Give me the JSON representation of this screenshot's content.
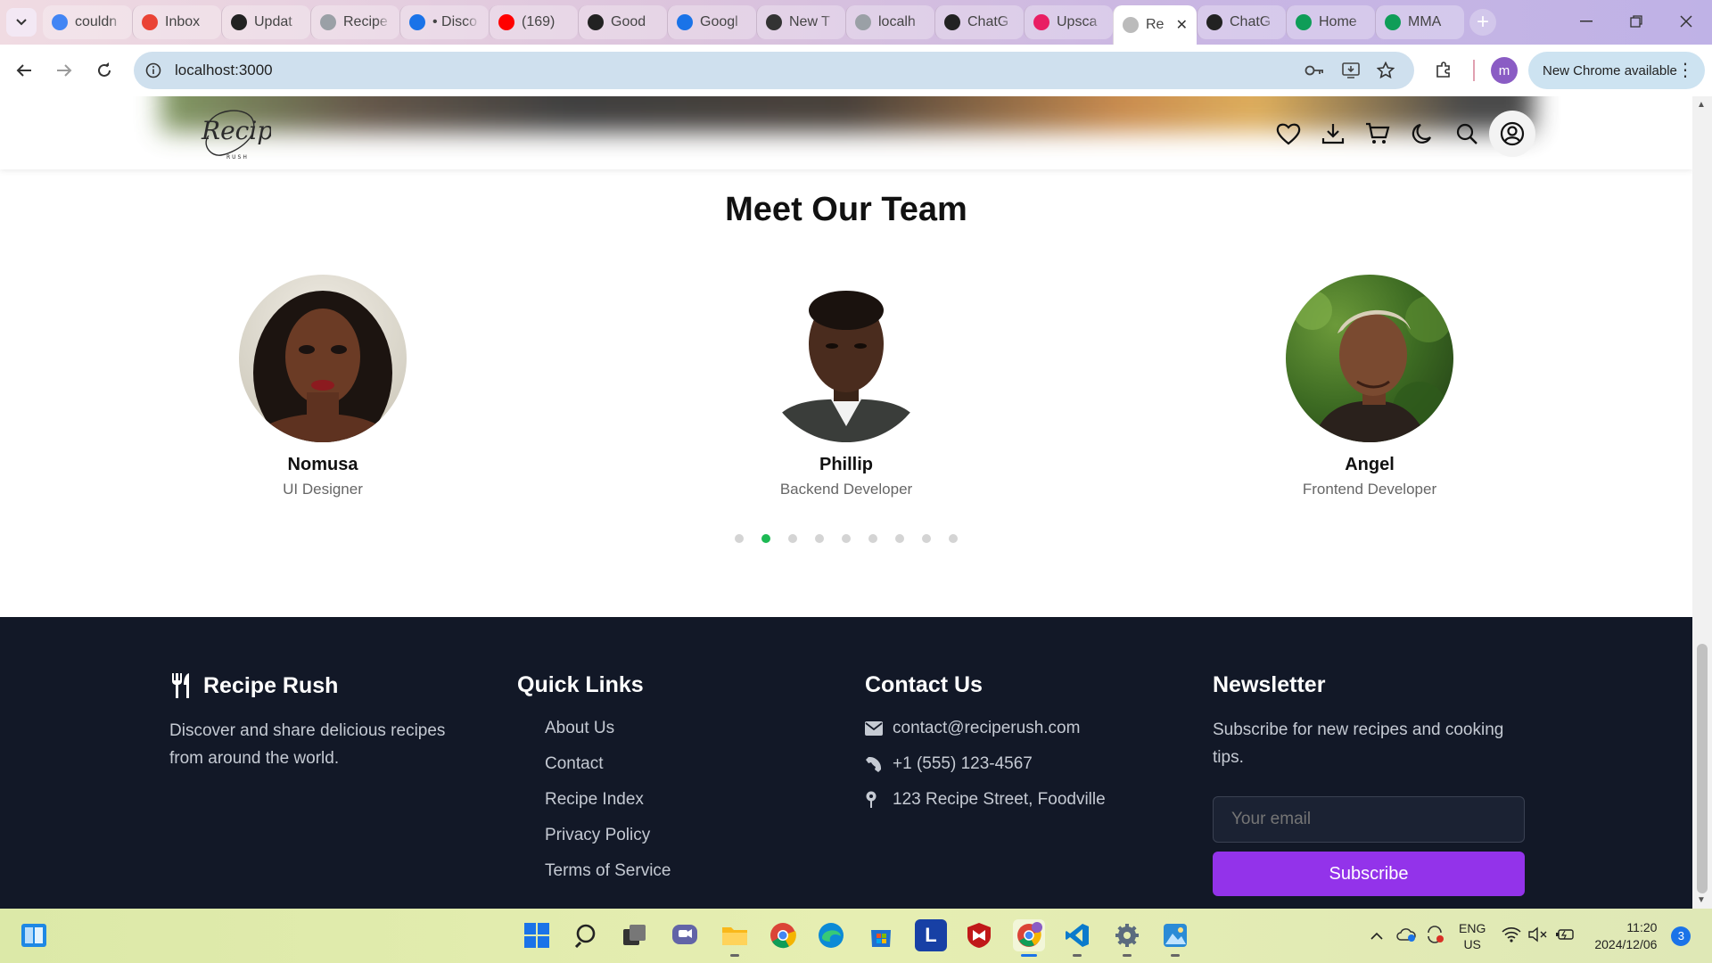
{
  "browser": {
    "tabs": [
      {
        "label": "couldn",
        "icon": "google-icon",
        "color": "#4285f4"
      },
      {
        "label": "Inbox",
        "icon": "gmail-icon",
        "color": "#ea4335"
      },
      {
        "label": "Updat",
        "icon": "github-icon",
        "color": "#222222"
      },
      {
        "label": "Recipe",
        "icon": "web-icon",
        "color": "#9aa0a6"
      },
      {
        "label": "• Disco",
        "icon": "chrome-remote-icon",
        "color": "#1a73e8"
      },
      {
        "label": "(169)",
        "icon": "youtube-icon",
        "color": "#ff0000"
      },
      {
        "label": "Good",
        "icon": "openai-icon",
        "color": "#222222"
      },
      {
        "label": "Googl",
        "icon": "google-calendar-icon",
        "color": "#1a73e8"
      },
      {
        "label": "New T",
        "icon": "chrome-icon",
        "color": "#333333"
      },
      {
        "label": "localh",
        "icon": "web-icon",
        "color": "#9aa0a6"
      },
      {
        "label": "ChatG",
        "icon": "openai-icon",
        "color": "#222222"
      },
      {
        "label": "Upsca",
        "icon": "pixelcut-icon",
        "color": "#e91e63"
      }
    ],
    "active_tab": {
      "label": "Re",
      "icon": "web-icon"
    },
    "tabs_after": [
      {
        "label": "ChatG",
        "icon": "openai-icon",
        "color": "#222222"
      },
      {
        "label": "Home",
        "icon": "google-drive-icon",
        "color": "#0f9d58"
      },
      {
        "label": "MMA",
        "icon": "google-sheets-icon",
        "color": "#0f9d58"
      }
    ],
    "url": "localhost:3000",
    "profile_initial": "m",
    "update_label": "New Chrome available"
  },
  "site": {
    "logo_text": "Recipe",
    "logo_subtext": "RUSH",
    "team_title": "Meet Our Team",
    "team": [
      {
        "name": "Nomusa",
        "role": "UI Designer"
      },
      {
        "name": "Phillip",
        "role": "Backend Developer"
      },
      {
        "name": "Angel",
        "role": "Frontend Developer"
      }
    ],
    "carousel_dots": 9,
    "carousel_active": 2
  },
  "footer": {
    "brand": "Recipe Rush",
    "brand_text": "Discover and share delicious recipes from around the world.",
    "quick_links_title": "Quick Links",
    "quick_links": [
      "About Us",
      "Contact",
      "Recipe Index",
      "Privacy Policy",
      "Terms of Service"
    ],
    "contact_title": "Contact Us",
    "contact": {
      "email": "contact@reciperush.com",
      "phone": "+1 (555) 123-4567",
      "address": "123 Recipe Street, Foodville"
    },
    "newsletter_title": "Newsletter",
    "newsletter_text": "Subscribe for new recipes and cooking tips.",
    "email_placeholder": "Your email",
    "subscribe_label": "Subscribe",
    "accent": "#9333ea",
    "background": "#121827"
  },
  "taskbar": {
    "lang": "ENG",
    "region": "US",
    "time": "11:20",
    "date": "2024/12/06",
    "notifications": "3"
  }
}
